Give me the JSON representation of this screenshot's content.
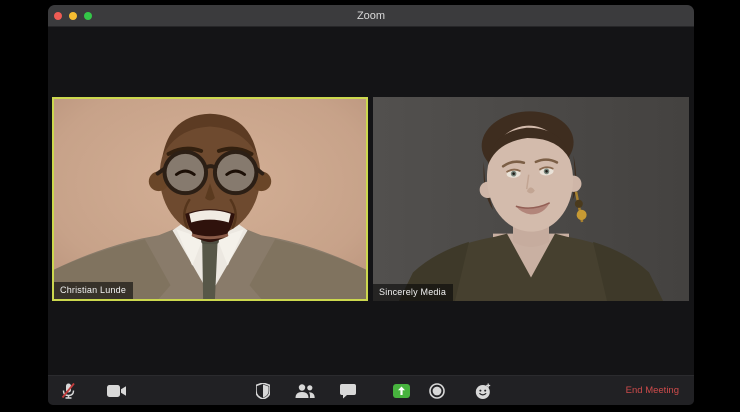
{
  "window": {
    "title": "Zoom"
  },
  "titlebar": {
    "traffic_lights": [
      "close",
      "minimize",
      "zoom"
    ]
  },
  "participants": [
    {
      "name": "Christian Lunde",
      "active_speaker": true
    },
    {
      "name": "Sincerely Media",
      "active_speaker": false
    }
  ],
  "toolbar": {
    "buttons": [
      {
        "id": "mute",
        "icon": "microphone-muted-icon",
        "state": "muted"
      },
      {
        "id": "start-video",
        "icon": "video-camera-icon",
        "state": "on"
      },
      {
        "id": "security",
        "icon": "shield-icon"
      },
      {
        "id": "participants",
        "icon": "participants-icon"
      },
      {
        "id": "chat",
        "icon": "chat-bubble-icon"
      },
      {
        "id": "share-screen",
        "icon": "share-screen-icon"
      },
      {
        "id": "record",
        "icon": "record-icon"
      },
      {
        "id": "reactions",
        "icon": "reactions-icon"
      }
    ],
    "end_meeting_label": "End Meeting"
  },
  "colors": {
    "active_speaker_border": "#ccd84e",
    "share_screen_green": "#47b33e",
    "end_meeting_red": "#cd4b4b",
    "titlebar_bg": "#3b3b3d",
    "toolbar_bg": "#212124",
    "stage_bg": "#141416"
  }
}
